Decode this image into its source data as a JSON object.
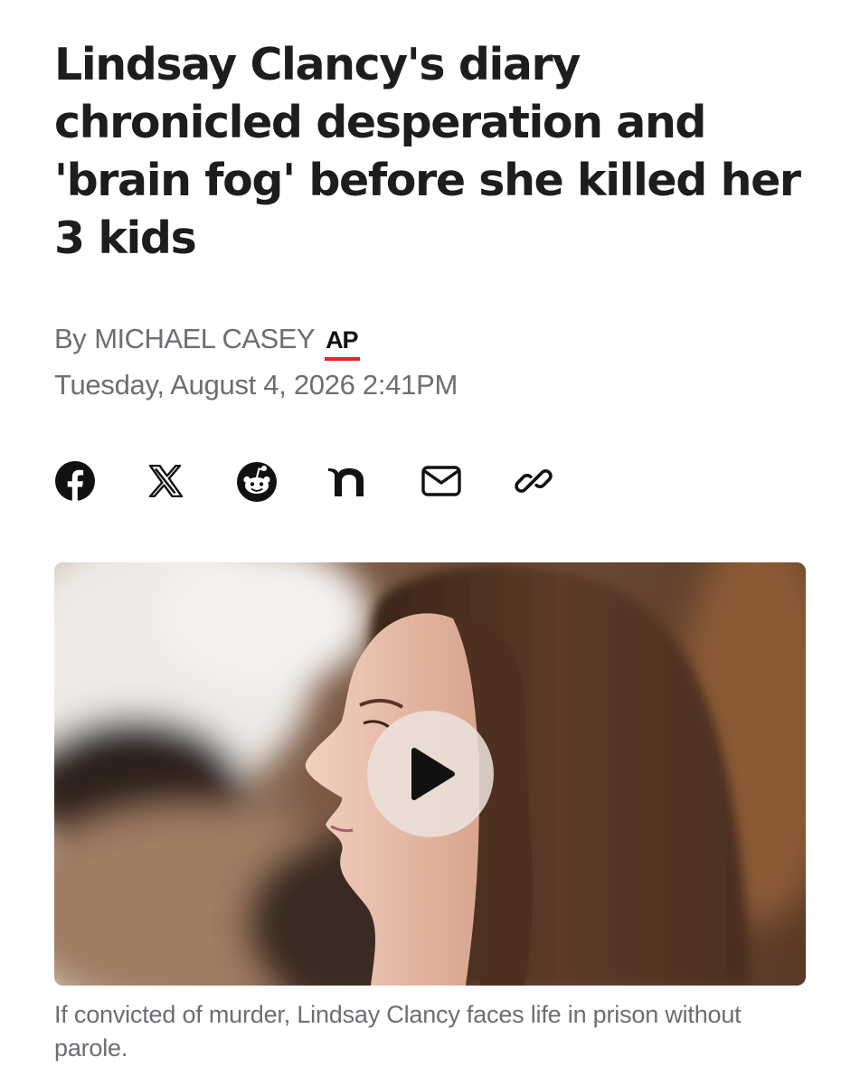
{
  "article": {
    "headline": "Lindsay Clancy's diary chronicled desperation and 'brain fog' before she killed her 3 kids",
    "byline_prefix": "By",
    "author": "MICHAEL CASEY",
    "source_logo": "AP",
    "date": "Tuesday, August 4, 2026 2:41PM",
    "caption": "If convicted of murder, Lindsay Clancy faces life in prison without parole."
  },
  "share": {
    "items": [
      {
        "icon": "facebook-icon"
      },
      {
        "icon": "x-icon"
      },
      {
        "icon": "reddit-icon"
      },
      {
        "icon": "nextdoor-icon"
      },
      {
        "icon": "email-icon"
      },
      {
        "icon": "link-icon"
      }
    ]
  },
  "media": {
    "type": "video",
    "play_icon": "play-icon"
  },
  "colors": {
    "text": "#1d1d1f",
    "muted": "#6b6e72",
    "ap_underline": "#e8232a",
    "play_button_bg": "#ebe2dc"
  }
}
